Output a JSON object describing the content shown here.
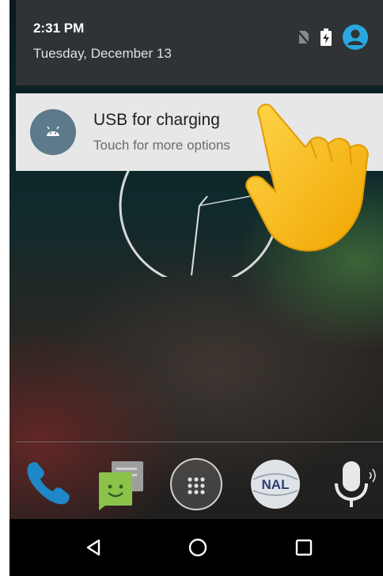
{
  "status_shade": {
    "time": "2:31 PM",
    "date": "Tuesday, December 13",
    "icons": [
      "no-sim-icon",
      "battery-charging-icon",
      "account-icon"
    ]
  },
  "notification": {
    "title": "USB for charging",
    "subtitle": "Touch for more options",
    "icon": "android-icon"
  },
  "overlay": {
    "icon": "pointing-hand-icon"
  },
  "dock": {
    "apps": [
      "phone-icon",
      "messaging-icon",
      "app-drawer-icon",
      "browser-icon",
      "voice-search-icon"
    ],
    "browser_logo_text": "NAL"
  },
  "navbar": {
    "buttons": [
      "back-icon",
      "home-icon",
      "recents-icon"
    ]
  },
  "colors": {
    "accent": "#2aa7df",
    "notification_bg": "#e7e7e7",
    "shade_bg": "#2f3336",
    "hand": "#f7b500"
  }
}
